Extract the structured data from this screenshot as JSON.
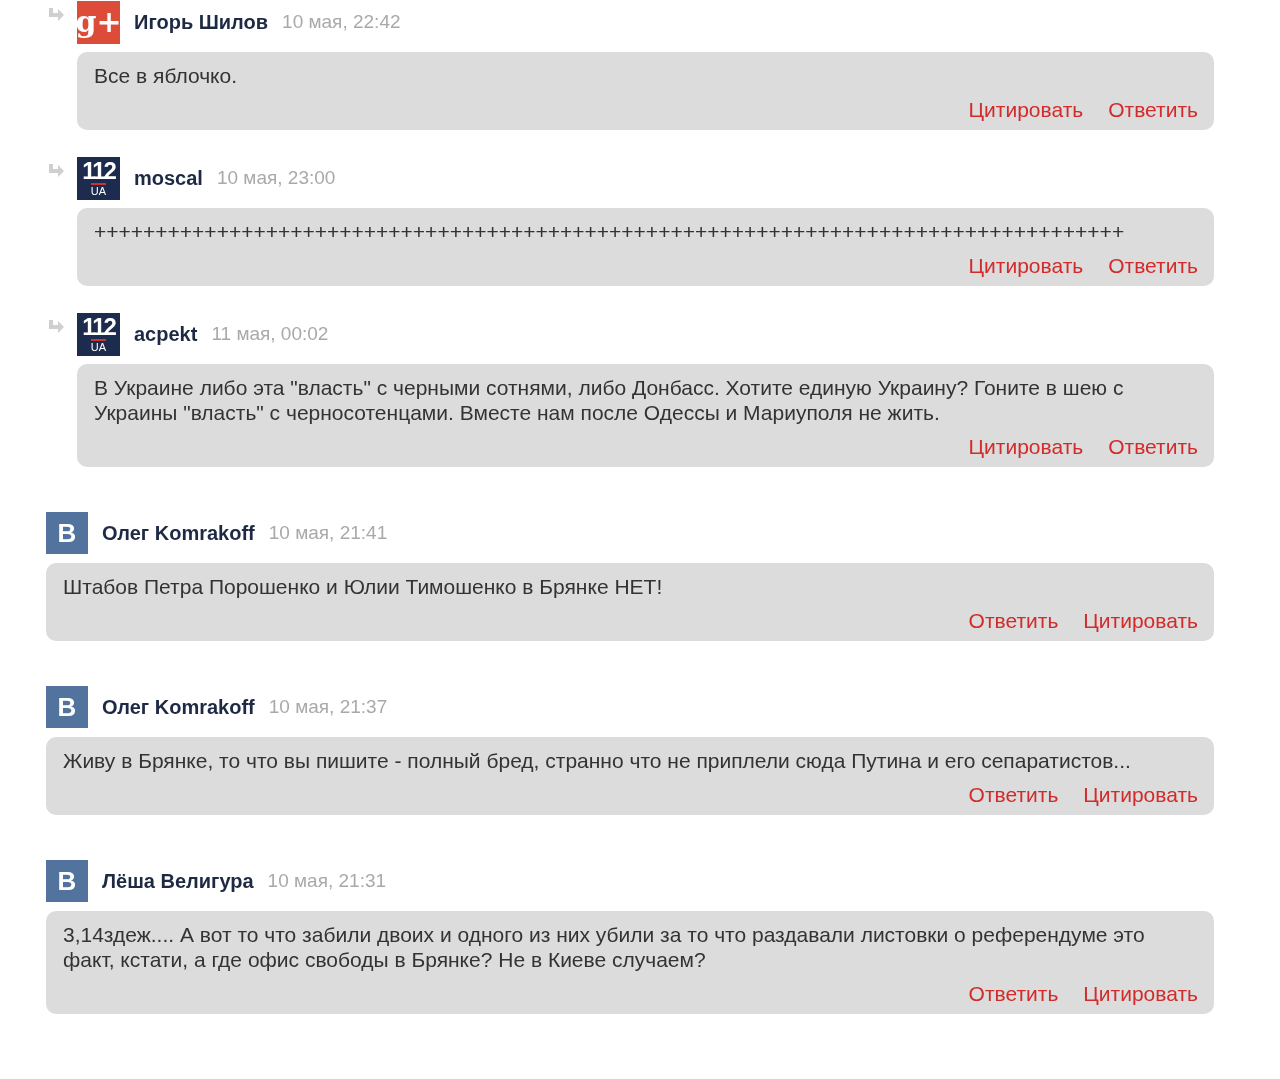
{
  "comments": [
    {
      "reply": true,
      "avatar": {
        "kind": "gplus",
        "text": "g+"
      },
      "author": "Игорь Шилов",
      "date": "10 мая, 22:42",
      "text": "Все в яблочко.",
      "actions": [
        "Цитировать",
        "Ответить"
      ]
    },
    {
      "reply": true,
      "avatar": {
        "kind": "channel",
        "text": "112",
        "sub": "UA"
      },
      "author": "moscal",
      "date": "10 мая, 23:00",
      "text": "++++++++++++++++++++++++++++++++++++++++++++++++++++++++++++++++++++++++++++++++++++",
      "actions": [
        "Цитировать",
        "Ответить"
      ]
    },
    {
      "reply": true,
      "avatar": {
        "kind": "channel",
        "text": "112",
        "sub": "UA"
      },
      "author": "acpekt",
      "date": "11 мая, 00:02",
      "text": "В Украине либо эта \"власть\" с черными сотнями, либо Донбасс. Хотите единую Украину? Гоните в шею с Украины \"власть\" с черносотенцами. Вместе нам после Одессы и Мариуполя не жить.",
      "actions": [
        "Цитировать",
        "Ответить"
      ]
    },
    {
      "reply": false,
      "avatar": {
        "kind": "vk",
        "text": "B"
      },
      "author": "Олег Komrakoff",
      "date": "10 мая, 21:41",
      "text": "Штабов Петра Порошенко и Юлии Тимошенко в Брянке НЕТ!",
      "actions": [
        "Ответить",
        "Цитировать"
      ]
    },
    {
      "reply": false,
      "avatar": {
        "kind": "vk",
        "text": "B"
      },
      "author": "Олег Komrakoff",
      "date": "10 мая, 21:37",
      "text": "Живу в Брянке, то что вы пишите - полный бред, странно что не приплели сюда Путина и его сепаратистов...",
      "actions": [
        "Ответить",
        "Цитировать"
      ]
    },
    {
      "reply": false,
      "avatar": {
        "kind": "vk",
        "text": "B"
      },
      "author": "Лёша Велигура",
      "date": "10 мая, 21:31",
      "text": "3,14здеж.... А вот то что забили двоих и одного из них убили за то что раздавали листовки о референдуме это факт, кстати, а где офис свободы в Брянке? Не в Киеве случаем?",
      "actions": [
        "Ответить",
        "Цитировать"
      ]
    }
  ]
}
